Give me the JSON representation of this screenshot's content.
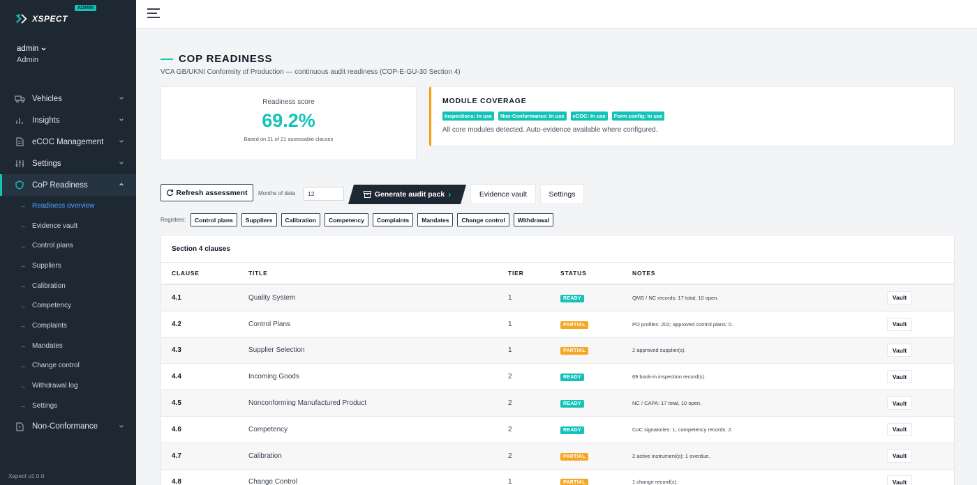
{
  "app": {
    "brand": "XSPECT",
    "admin_badge": "ADMIN",
    "user_name": "admin",
    "user_role": "Admin",
    "version": "Xspect v2.0.0"
  },
  "sidebar": {
    "items": [
      {
        "label": "Vehicles",
        "icon": "truck-icon"
      },
      {
        "label": "Insights",
        "icon": "bar-chart-icon"
      },
      {
        "label": "eCOC Management",
        "icon": "document-icon"
      },
      {
        "label": "Settings",
        "icon": "sliders-icon"
      },
      {
        "label": "CoP Readiness",
        "icon": "shield-icon"
      },
      {
        "label": "Non-Conformance",
        "icon": "file-alert-icon"
      }
    ],
    "subitems": [
      "Readiness overview",
      "Evidence vault",
      "Control plans",
      "Suppliers",
      "Calibration",
      "Competency",
      "Complaints",
      "Mandates",
      "Change control",
      "Withdrawal log",
      "Settings"
    ]
  },
  "page": {
    "title": "COP READINESS",
    "subtitle": "VCA GB/UKNI Conformity of Production — continuous audit readiness (COP-E-GU-30 Section 4)"
  },
  "score": {
    "label": "Readiness score",
    "value": "69.2%",
    "note": "Based on 21 of 21 assessable clauses"
  },
  "coverage": {
    "title": "MODULE COVERAGE",
    "badges": [
      "Inspections: In use",
      "Non-Conformance: In use",
      "eCOC: In use",
      "Form config: In use"
    ],
    "note": "All core modules detected. Auto-evidence available where configured."
  },
  "toolbar": {
    "refresh": "Refresh assessment",
    "months_label": "Months of data",
    "months_value": "12",
    "generate": "Generate audit pack",
    "evidence_vault": "Evidence vault",
    "settings": "Settings"
  },
  "registers": {
    "label": "Registers:",
    "items": [
      "Control plans",
      "Suppliers",
      "Calibration",
      "Competency",
      "Complaints",
      "Mandates",
      "Change control",
      "Withdrawal"
    ]
  },
  "table": {
    "title": "Section 4 clauses",
    "headers": {
      "clause": "CLAUSE",
      "title": "TITLE",
      "tier": "TIER",
      "status": "STATUS",
      "notes": "NOTES"
    },
    "vault_label": "Vault",
    "rows": [
      {
        "clause": "4.1",
        "title": "Quality System",
        "tier": "1",
        "status": "READY",
        "notes": "QMS / NC records: 17 total; 10 open."
      },
      {
        "clause": "4.2",
        "title": "Control Plans",
        "tier": "1",
        "status": "PARTIAL",
        "notes": "PO profiles: 202; approved control plans: 0."
      },
      {
        "clause": "4.3",
        "title": "Supplier Selection",
        "tier": "1",
        "status": "PARTIAL",
        "notes": "2 approved supplier(s)."
      },
      {
        "clause": "4.4",
        "title": "Incoming Goods",
        "tier": "2",
        "status": "READY",
        "notes": "69 book-in inspection record(s)."
      },
      {
        "clause": "4.5",
        "title": "Nonconforming Manufactured Product",
        "tier": "2",
        "status": "READY",
        "notes": "NC / CAPA: 17 total, 10 open."
      },
      {
        "clause": "4.6",
        "title": "Competency",
        "tier": "2",
        "status": "READY",
        "notes": "CoC signatories: 1; competency records: 2."
      },
      {
        "clause": "4.7",
        "title": "Calibration",
        "tier": "2",
        "status": "PARTIAL",
        "notes": "2 active instrument(s); 1 overdue."
      },
      {
        "clause": "4.8",
        "title": "Change Control",
        "tier": "1",
        "status": "PARTIAL",
        "notes": "1 change record(s)."
      }
    ]
  }
}
